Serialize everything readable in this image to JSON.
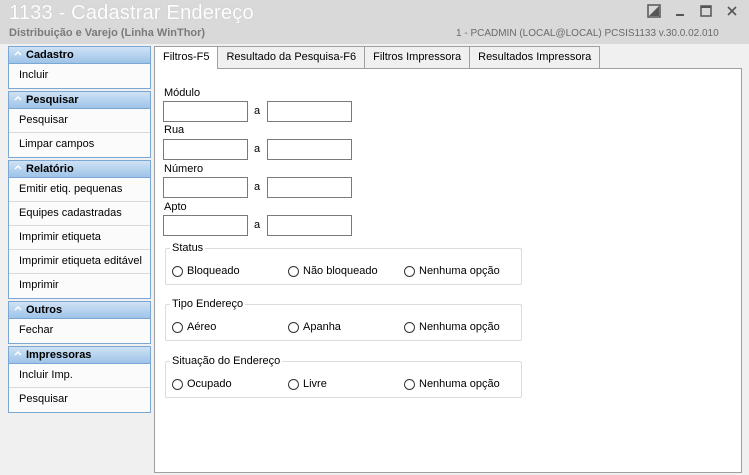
{
  "window": {
    "title": "1133 - Cadastrar Endereço",
    "subtitle": "Distribuição e Varejo (Linha WinThor)",
    "info": "1 - PCADMIN (LOCAL@LOCAL)   PCSIS1133  v.30.0.02.010"
  },
  "sidebar": {
    "cadastro": {
      "title": "Cadastro",
      "items": [
        "Incluir"
      ]
    },
    "pesquisar": {
      "title": "Pesquisar",
      "items": [
        "Pesquisar",
        "Limpar campos"
      ]
    },
    "relatorio": {
      "title": "Relatório",
      "items": [
        "Emitir etiq. pequenas",
        "Equipes cadastradas",
        "Imprimir etiqueta",
        "Imprimir etiqueta editável",
        "Imprimir"
      ]
    },
    "outros": {
      "title": "Outros",
      "items": [
        "Fechar"
      ]
    },
    "impressoras": {
      "title": "Impressoras",
      "items": [
        "Incluir Imp.",
        "Pesquisar"
      ]
    }
  },
  "tabs": [
    "Filtros-F5",
    "Resultado da Pesquisa-F6",
    "Filtros Impressora",
    "Resultados Impressora"
  ],
  "form": {
    "range_separator": "a",
    "fields": [
      {
        "label": "Módulo",
        "from": "",
        "to": ""
      },
      {
        "label": "Rua",
        "from": "",
        "to": ""
      },
      {
        "label": "Número",
        "from": "",
        "to": ""
      },
      {
        "label": "Apto",
        "from": "",
        "to": ""
      }
    ],
    "groups": [
      {
        "legend": "Status",
        "options": [
          "Bloqueado",
          "Não bloqueado",
          "Nenhuma opção"
        ]
      },
      {
        "legend": "Tipo Endereço",
        "options": [
          "Aéreo",
          "Apanha",
          "Nenhuma opção"
        ]
      },
      {
        "legend": "Situação do Endereço",
        "options": [
          "Ocupado",
          "Livre",
          "Nenhuma opção"
        ]
      }
    ]
  }
}
